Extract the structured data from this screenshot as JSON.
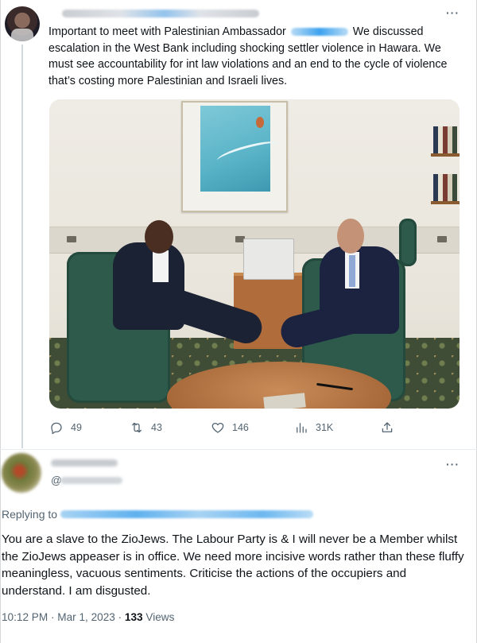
{
  "tweet": {
    "text_before_mention": "Important to meet with Palestinian Ambassador ",
    "text_after_mention": " We discussed escalation in the West Bank including shocking settler violence in Hawara. We must see accountability for int law violations and an end to the cycle of violence that’s costing more Palestinian and Israeli lives.",
    "more_icon": "more-dots-icon",
    "actions": {
      "replies": "49",
      "retweets": "43",
      "likes": "146",
      "views": "31K"
    }
  },
  "reply": {
    "handle_prefix": "@",
    "replying_to_label": "Replying to",
    "text": "You are a slave to the ZioJews. The Labour Party is & I will never be a Member whilst the ZioJews appeaser is in office. We need more incisive words rather than these fluffy meaningless, vacuous sentiments. Criticise the actions of the occupiers and understand. I am disgusted.",
    "time": "10:12 PM",
    "date": "Mar 1, 2023",
    "separator": " · ",
    "views_count": "133",
    "views_label": " Views"
  },
  "colors": {
    "text": "#0f1419",
    "secondary": "#536471",
    "link": "#1d9bf0",
    "thread_line": "#cfd9de"
  }
}
